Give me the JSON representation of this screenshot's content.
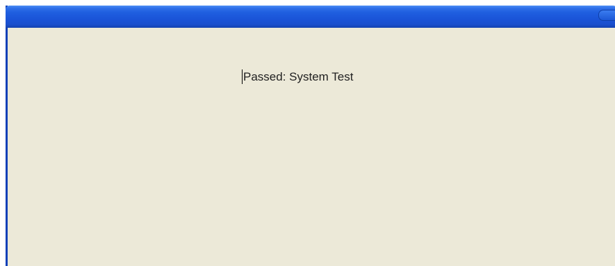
{
  "window": {
    "title": "",
    "accent_color": "#1a54d8",
    "background_color": "#ece9d8"
  },
  "content": {
    "status_text": "Passed: System Test"
  }
}
